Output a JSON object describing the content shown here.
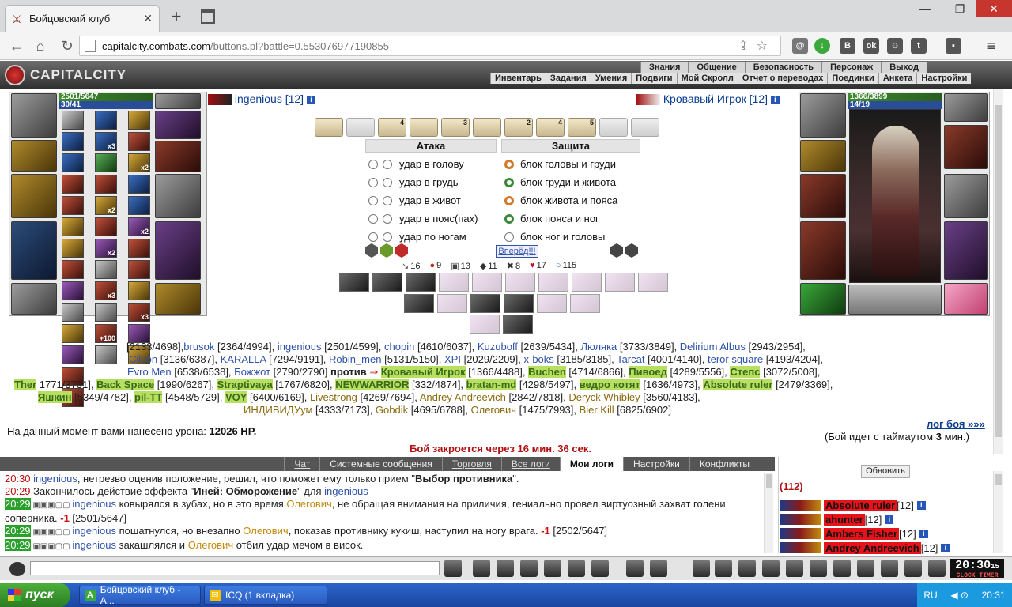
{
  "browser": {
    "tab_title": "Бойцовский клуб",
    "url_host": "capitalcity.combats.com",
    "url_path": "/buttons.pl?battle=0.553076977190855"
  },
  "header": {
    "logo": "CAPITALCITY",
    "top_menu": [
      "Знания",
      "Общение",
      "Безопасность",
      "Персонаж",
      "Выход"
    ],
    "sub_menu": [
      "Инвентарь",
      "Задания",
      "Умения",
      "Подвиги",
      "Мой Скролл",
      "Отчет о переводах",
      "Поединки",
      "Анкета",
      "Настройки"
    ]
  },
  "player": {
    "name": "ingenious",
    "level": "[12]",
    "hp": "2501/5647",
    "mp": "30/41"
  },
  "enemy": {
    "name": "Кровавый Игрок",
    "level": "[12]",
    "hp": "1366/3899",
    "mp": "14/19"
  },
  "scrolls": [
    "",
    "",
    "4",
    "",
    "3",
    "",
    "2",
    "4",
    "5",
    "",
    ""
  ],
  "attack": {
    "title": "Атака",
    "rows": [
      "удар в голову",
      "удар в грудь",
      "удар в живот",
      "удар в пояс(пах)",
      "удар по ногам"
    ]
  },
  "defense": {
    "title": "Защита",
    "rows": [
      "блок головы и груди",
      "блок груди и живота",
      "блок живота и пояса",
      "блок пояса и ног",
      "блок ног и головы"
    ]
  },
  "forward_button": "Вперёд!!!",
  "stats": [
    {
      "icon": "sword",
      "value": "16"
    },
    {
      "icon": "drop",
      "value": "9"
    },
    {
      "icon": "shield",
      "value": "13"
    },
    {
      "icon": "armor",
      "value": "11"
    },
    {
      "icon": "cross",
      "value": "8"
    },
    {
      "icon": "heart",
      "value": "17"
    },
    {
      "icon": "ring",
      "value": "115"
    }
  ],
  "battle_line1_pre": "[2133/4698],",
  "battle": [
    {
      "n": "brusok",
      "h": "[2364/4994],",
      "c": "a"
    },
    {
      "n": "ingenious",
      "h": "[2501/4599],",
      "c": "a"
    },
    {
      "n": "chopin",
      "h": "[4610/6037],",
      "c": "a"
    },
    {
      "n": "Kuzuboff",
      "h": "[2639/5434],",
      "c": "a"
    },
    {
      "n": "Люляка",
      "h": "[3733/3849],",
      "c": "a"
    },
    {
      "n": "Delirium Albus",
      "h": "[2943/2954],",
      "c": "a"
    }
  ],
  "battle2": [
    {
      "n": "Ciklon",
      "h": "[3136/6387],",
      "c": "a"
    },
    {
      "n": "KARALLA",
      "h": "[7294/9191],",
      "c": "a"
    },
    {
      "n": "Robin_men",
      "h": "[5131/5150],",
      "c": "a"
    },
    {
      "n": "XPI",
      "h": "[2029/2209],",
      "c": "a"
    },
    {
      "n": "x-boks",
      "h": "[3185/3185],",
      "c": "a"
    },
    {
      "n": "Tarcat",
      "h": "[4001/4140],",
      "c": "a"
    },
    {
      "n": "teror square",
      "h": "[4193/4204],",
      "c": "a"
    }
  ],
  "battle3a": [
    {
      "n": "Evro Men",
      "h": "[6538/6538],",
      "c": "a"
    },
    {
      "n": "Божжот",
      "h": "[2790/2790]",
      "c": "a"
    }
  ],
  "vs": "против",
  "battle3b": [
    {
      "n": "Кровавый Игрок",
      "h": "[1366/4488],",
      "c": "b"
    },
    {
      "n": "Buchen",
      "h": "[4714/6866],",
      "c": "b"
    },
    {
      "n": "Пивоед",
      "h": "[4289/5556],",
      "c": "b"
    },
    {
      "n": "Степс",
      "h": "[3072/5008],",
      "c": "b"
    }
  ],
  "battle4": [
    {
      "n": "Ther",
      "h": "1771/3731],",
      "c": "b"
    },
    {
      "n": "Back Space",
      "h": "[1990/6267],",
      "c": "b"
    },
    {
      "n": "Straptivaya",
      "h": "[1767/6820],",
      "c": "b"
    },
    {
      "n": "NEWWARRIOR",
      "h": "[332/4874],",
      "c": "b"
    },
    {
      "n": "bratan-md",
      "h": "[4298/5497],",
      "c": "b"
    },
    {
      "n": "ведро котят",
      "h": "[1636/4973],",
      "c": "b"
    },
    {
      "n": "Absolute ruler",
      "h": "[2479/3369],",
      "c": "b"
    }
  ],
  "battle5": [
    {
      "n": "Яшкин",
      "h": "[5349/4782],",
      "c": "b"
    },
    {
      "n": "pil-TT",
      "h": "[4548/5729],",
      "c": "b"
    },
    {
      "n": "VOY",
      "h": "[6400/6169],",
      "c": "b"
    },
    {
      "n": "Livestrong",
      "h": "[4269/7694],",
      "c": "c"
    },
    {
      "n": "Andrey Andreevich",
      "h": "[2842/7818],",
      "c": "c"
    },
    {
      "n": "Deryck Whibley",
      "h": "[3560/4183],",
      "c": "c"
    }
  ],
  "battle6": [
    {
      "n": "ИНДИВИДУум",
      "h": "[4333/7173],",
      "c": "c"
    },
    {
      "n": "Gobdik",
      "h": "[4695/6788],",
      "c": "c"
    },
    {
      "n": "Олегович",
      "h": "[1475/7993],",
      "c": "c"
    },
    {
      "n": "Bier Kill",
      "h": "[6825/6902]",
      "c": "c"
    }
  ],
  "log_link": "лог боя »»»",
  "timer_mode": "(Бой идет с таймаутом",
  "timer_val": "3",
  "timer_unit": "мин.)",
  "damage_label": "На данный момент вами нанесено урона:",
  "damage_value": "12026 HP.",
  "close_notice": "Бой закроется через 16 мин. 36 сек.",
  "chat_tabs": [
    "Чат",
    "Системные сообщения",
    "Торговля",
    "Все логи",
    "Мои логи",
    "Настройки",
    "Конфликты"
  ],
  "chat": [
    {
      "t": "20:30",
      "parts": [
        [
          "u",
          "ingenious"
        ],
        [
          "x",
          ", нетрезво оценив положение, решил, что поможет ему только прием \""
        ],
        [
          "b",
          "Выбор противника"
        ],
        [
          "x",
          "\"."
        ]
      ]
    },
    {
      "t": "20:29",
      "parts": [
        [
          "x",
          "Закончилось действие эффекта \""
        ],
        [
          "b",
          "Иней: Обморожение"
        ],
        [
          "x",
          "\" для "
        ],
        [
          "u",
          "ingenious"
        ]
      ]
    },
    {
      "t": "20:29",
      "g": true,
      "parts": [
        [
          "u",
          "ingenious"
        ],
        [
          "x",
          " ковырялся в зубах, но в это время "
        ],
        [
          "o",
          "Олегович"
        ],
        [
          "x",
          ", не обращая внимания на приличия, гениально провел виртуозный захват голени соперника. "
        ],
        [
          "n",
          "-1"
        ],
        [
          "x",
          " [2501/5647]"
        ]
      ]
    },
    {
      "t": "20:29",
      "g": true,
      "parts": [
        [
          "u",
          "ingenious"
        ],
        [
          "x",
          " пошатнулся, но внезапно "
        ],
        [
          "o",
          "Олегович"
        ],
        [
          "x",
          ", показав противнику кукиш, наступил на ногу врага. "
        ],
        [
          "n",
          "-1"
        ],
        [
          "x",
          " [2502/5647]"
        ]
      ]
    },
    {
      "t": "20:29",
      "g": true,
      "parts": [
        [
          "u",
          "ingenious"
        ],
        [
          "x",
          " закашлялся и "
        ],
        [
          "o",
          "Олегович"
        ],
        [
          "x",
          " отбил удар мечом в висок."
        ]
      ]
    }
  ],
  "users": {
    "refresh": "Обновить",
    "count": "(112)",
    "list": [
      {
        "n": "Absolute ruler",
        "l": "[12]"
      },
      {
        "n": "ahunter",
        "l": "[12]"
      },
      {
        "n": "Ambers Fisher",
        "l": "[12]"
      },
      {
        "n": "Andrey Andreevich",
        "l": "[12]"
      }
    ]
  },
  "clock": {
    "time": "20:30",
    "secs": "15",
    "sub": "CLOCK TIMER"
  },
  "taskbar": {
    "start": "пуск",
    "tasks": [
      "Бойцовский клуб - А...",
      "ICQ (1 вкладка)"
    ],
    "lang": "RU",
    "time": "20:31"
  }
}
